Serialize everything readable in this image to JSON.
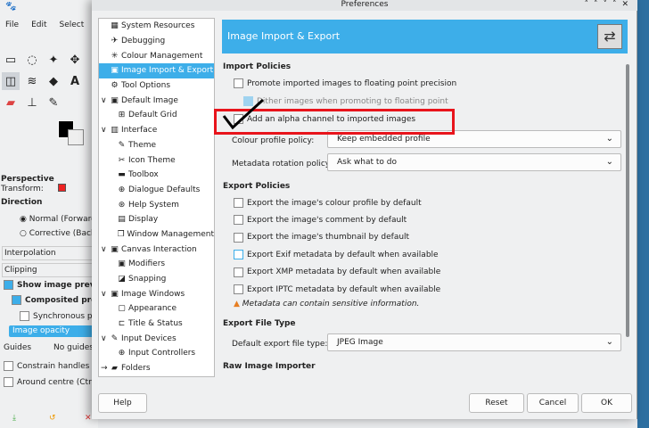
{
  "gimp": {
    "menu": [
      "File",
      "Edit",
      "Select"
    ],
    "tool_options": {
      "title": "Perspective",
      "transform_label": "Transform:",
      "direction_label": "Direction",
      "normal": "Normal (Forward)",
      "corrective": "Corrective (Backward)",
      "interpolation": "Interpolation",
      "clipping": "Clipping",
      "show_preview": "Show image preview",
      "composited": "Composited preview",
      "synchronous": "Synchronous preview",
      "opacity": "Image opacity",
      "guides_label": "Guides",
      "guides_value": "No guides",
      "constrain": "Constrain handles (Shift)",
      "around_centre": "Around centre (Ctrl)"
    }
  },
  "dialog": {
    "title": "Preferences",
    "tree": [
      {
        "label": "System Resources",
        "level": 0,
        "icon": "▦",
        "ex": ""
      },
      {
        "label": "Debugging",
        "level": 0,
        "icon": "✈",
        "ex": ""
      },
      {
        "label": "Colour Management",
        "level": 0,
        "icon": "✳",
        "ex": ""
      },
      {
        "label": "Image Import & Export",
        "level": 0,
        "icon": "▣",
        "ex": "",
        "selected": true
      },
      {
        "label": "Tool Options",
        "level": 0,
        "icon": "⚙",
        "ex": ""
      },
      {
        "label": "Default Image",
        "level": 0,
        "icon": "▣",
        "ex": "∨"
      },
      {
        "label": "Default Grid",
        "level": 1,
        "icon": "⊞",
        "ex": ""
      },
      {
        "label": "Interface",
        "level": 0,
        "icon": "▥",
        "ex": "∨"
      },
      {
        "label": "Theme",
        "level": 1,
        "icon": "✎",
        "ex": ""
      },
      {
        "label": "Icon Theme",
        "level": 1,
        "icon": "✂",
        "ex": ""
      },
      {
        "label": "Toolbox",
        "level": 1,
        "icon": "▬",
        "ex": ""
      },
      {
        "label": "Dialogue Defaults",
        "level": 1,
        "icon": "⊕",
        "ex": ""
      },
      {
        "label": "Help System",
        "level": 1,
        "icon": "⊛",
        "ex": ""
      },
      {
        "label": "Display",
        "level": 1,
        "icon": "▤",
        "ex": ""
      },
      {
        "label": "Window Management",
        "level": 1,
        "icon": "❐",
        "ex": ""
      },
      {
        "label": "Canvas Interaction",
        "level": 0,
        "icon": "▣",
        "ex": "∨"
      },
      {
        "label": "Modifiers",
        "level": 1,
        "icon": "▣",
        "ex": ""
      },
      {
        "label": "Snapping",
        "level": 1,
        "icon": "◪",
        "ex": ""
      },
      {
        "label": "Image Windows",
        "level": 0,
        "icon": "▣",
        "ex": "∨"
      },
      {
        "label": "Appearance",
        "level": 1,
        "icon": "▢",
        "ex": ""
      },
      {
        "label": "Title & Status",
        "level": 1,
        "icon": "⊏",
        "ex": ""
      },
      {
        "label": "Input Devices",
        "level": 0,
        "icon": "✎",
        "ex": "∨"
      },
      {
        "label": "Input Controllers",
        "level": 1,
        "icon": "⊕",
        "ex": ""
      },
      {
        "label": "Folders",
        "level": 0,
        "icon": "▰",
        "ex": "→"
      }
    ],
    "header": "Image Import & Export",
    "import": {
      "heading": "Import Policies",
      "promote": "Promote imported images to floating point precision",
      "dither": "Dither images when promoting to floating point",
      "alpha": "Add an alpha channel to imported images",
      "colour_label": "Colour profile policy:",
      "colour_value": "Keep embedded profile",
      "rotation_label": "Metadata rotation policy:",
      "rotation_value": "Ask what to do"
    },
    "export": {
      "heading": "Export Policies",
      "items": [
        "Export the image's colour profile by default",
        "Export the image's comment by default",
        "Export the image's thumbnail by default",
        "Export Exif metadata by default when available",
        "Export XMP metadata by default when available",
        "Export IPTC metadata by default when available"
      ],
      "warning": "Metadata can contain sensitive information."
    },
    "file_type": {
      "heading": "Export File Type",
      "label": "Default export file type:",
      "value": "JPEG Image"
    },
    "raw": {
      "heading": "Raw Image Importer"
    },
    "buttons": {
      "help": "Help",
      "reset": "Reset",
      "cancel": "Cancel",
      "ok": "OK"
    },
    "annotation_color": "#e8141c"
  }
}
